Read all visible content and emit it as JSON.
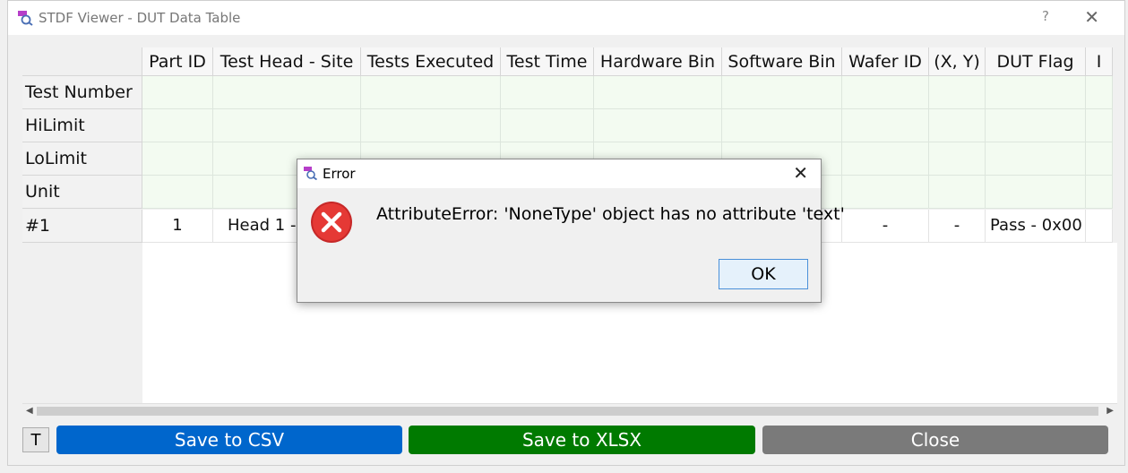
{
  "window": {
    "title": "STDF Viewer - DUT Data Table",
    "help_label": "?",
    "close_glyph": "✕"
  },
  "table": {
    "columns": [
      "Part ID",
      "Test Head - Site",
      "Tests Executed",
      "Test Time",
      "Hardware Bin",
      "Software Bin",
      "Wafer ID",
      "(X, Y)",
      "DUT Flag",
      "I"
    ],
    "row_headers": [
      "Test Number",
      "HiLimit",
      "LoLimit",
      "Unit",
      "#1"
    ],
    "dut_row": [
      "1",
      "Head 1 -",
      "",
      "",
      "",
      "",
      "-",
      "-",
      "Pass - 0x00",
      ""
    ]
  },
  "buttons": {
    "t_label": "T",
    "csv_label": "Save to CSV",
    "xlsx_label": "Save to XLSX",
    "close_label": "Close"
  },
  "dialog": {
    "title": "Error",
    "message": "AttributeError: 'NoneType' object has no attribute 'text'",
    "ok_label": "OK",
    "close_glyph": "✕"
  },
  "colors": {
    "csv_button": "#0066cc",
    "xlsx_button": "#007a00",
    "close_button": "#7a7a7a",
    "error_red": "#e53935",
    "meta_row_bg": "#f3fbf1"
  }
}
